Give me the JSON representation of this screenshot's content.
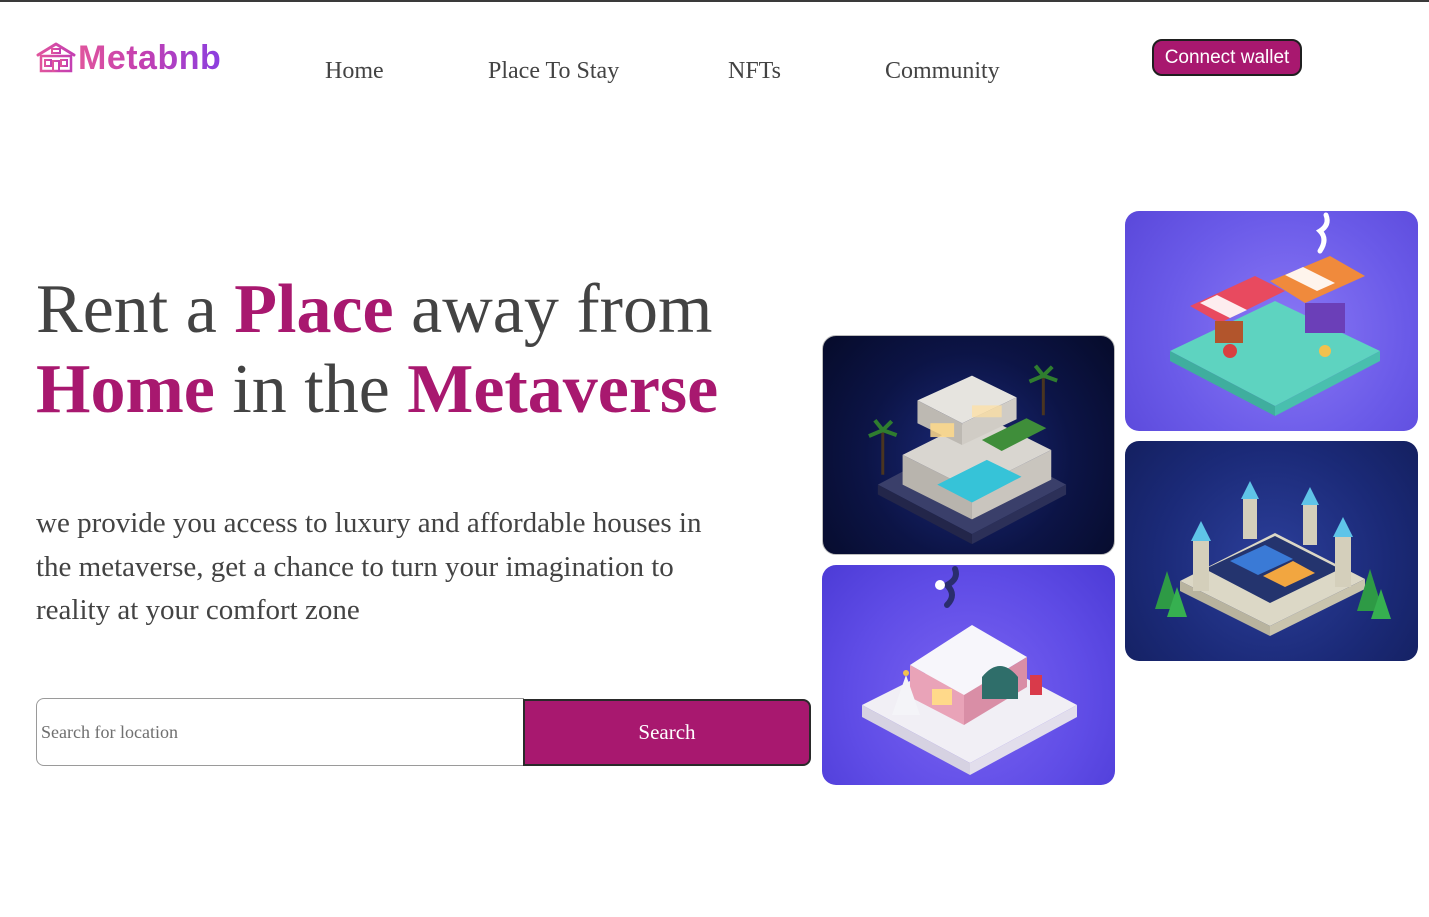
{
  "brand": {
    "name": "Metabnb",
    "logo_icon": "house-icon",
    "gradient": [
      "#e0559d",
      "#8a3fe0"
    ]
  },
  "nav": {
    "links": [
      "Home",
      "Place To Stay",
      "NFTs",
      "Community"
    ],
    "connect_label": "Connect wallet"
  },
  "hero": {
    "headline": {
      "w1": "Rent a ",
      "w2": "Place",
      "w3": " away from",
      "w4": "Home",
      "w5": " in the ",
      "w6": "Metaverse"
    },
    "lead": "we provide you access to luxury and affordable houses in the metaverse, get a chance to turn your imagination to reality at your comfort zone"
  },
  "search": {
    "placeholder": "Search for location",
    "value": "",
    "button_label": "Search"
  },
  "gallery": {
    "images": [
      {
        "name": "villa-with-pool-image"
      },
      {
        "name": "market-stall-image"
      },
      {
        "name": "castle-image"
      },
      {
        "name": "snowy-cottage-image"
      }
    ]
  },
  "colors": {
    "accent": "#a8186f",
    "text": "#434343",
    "background": "#ffffff"
  }
}
